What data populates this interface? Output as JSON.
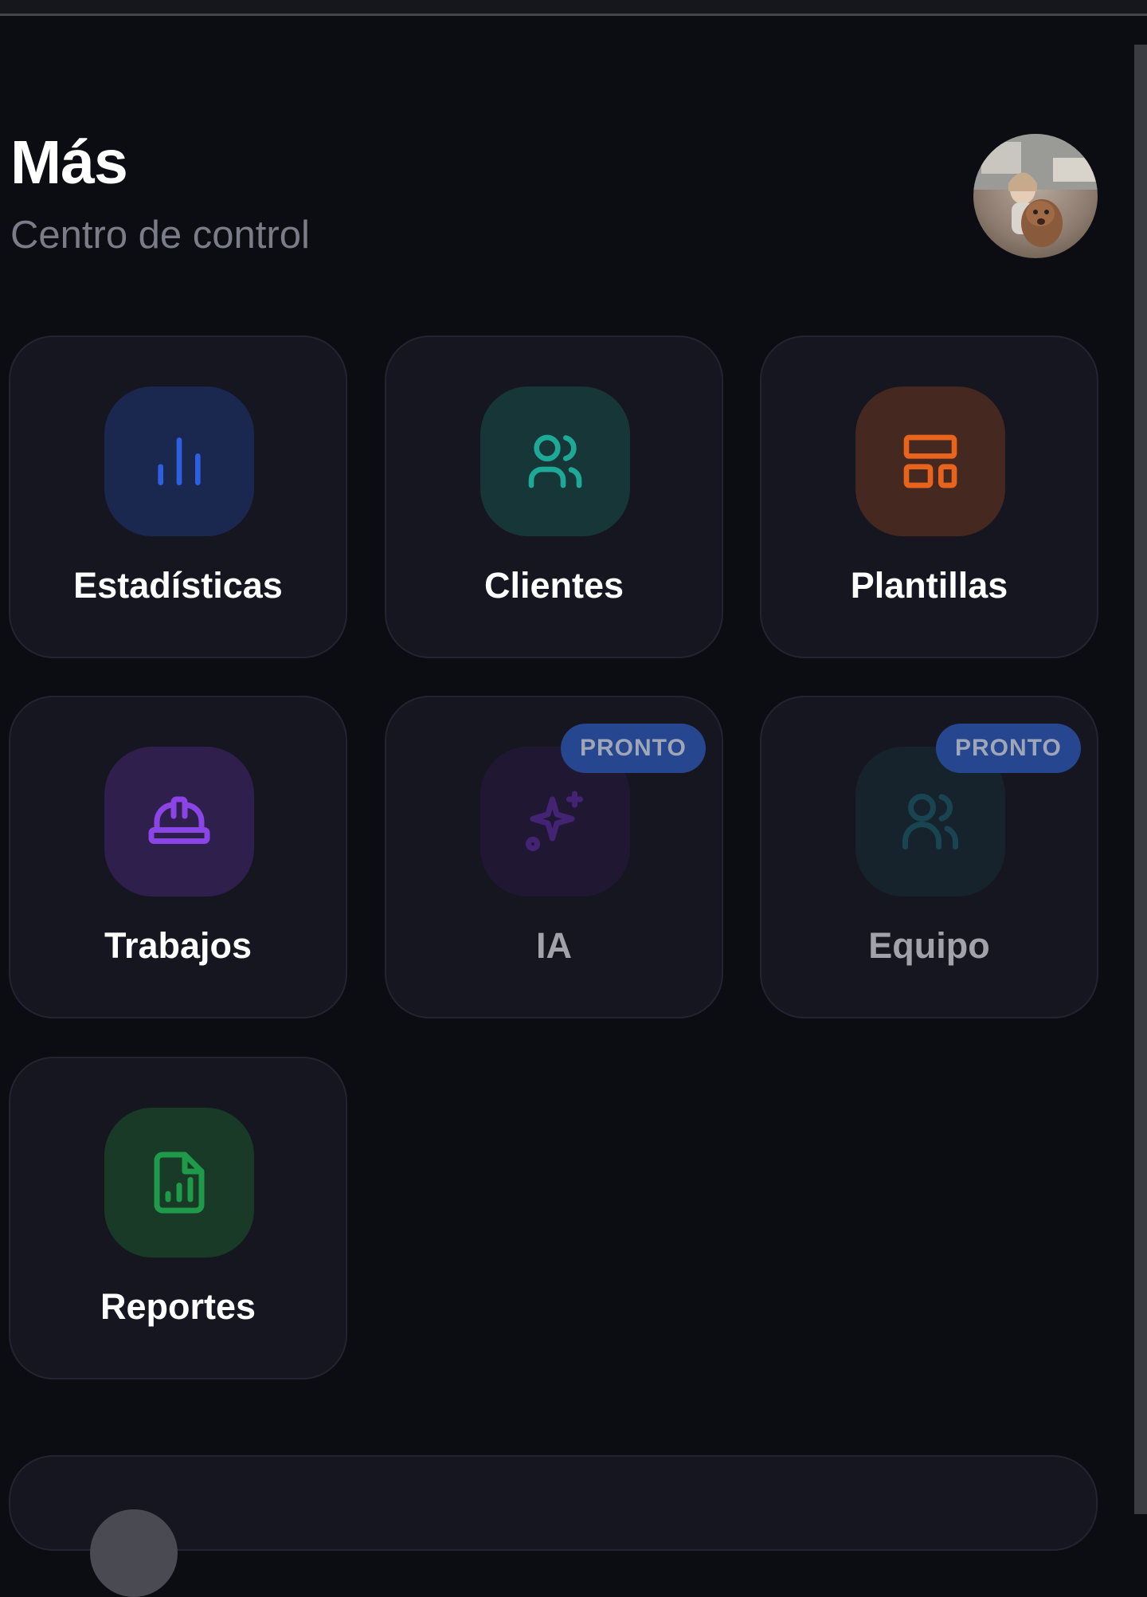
{
  "header": {
    "title": "Más",
    "subtitle": "Centro de control"
  },
  "tiles": [
    {
      "label": "Estadísticas",
      "icon": "bar-chart-icon",
      "accent": "#2d5fe0",
      "icon_bg": "#1a2850",
      "enabled": true
    },
    {
      "label": "Clientes",
      "icon": "users-icon",
      "accent": "#1ea896",
      "icon_bg": "#173637",
      "enabled": true
    },
    {
      "label": "Plantillas",
      "icon": "layout-template-icon",
      "accent": "#e8641c",
      "icon_bg": "#452920",
      "enabled": true
    },
    {
      "label": "Trabajos",
      "icon": "hard-hat-icon",
      "accent": "#8b44e6",
      "icon_bg": "#2e1f4d",
      "enabled": true
    },
    {
      "label": "IA",
      "icon": "sparkles-icon",
      "accent": "#6a2fb8",
      "icon_bg": "#2a1a44",
      "enabled": false,
      "badge": "PRONTO"
    },
    {
      "label": "Equipo",
      "icon": "users-icon",
      "accent": "#1e6a7a",
      "icon_bg": "#1a2f38",
      "enabled": false,
      "badge": "PRONTO"
    },
    {
      "label": "Reportes",
      "icon": "file-chart-icon",
      "accent": "#1f9a4a",
      "icon_bg": "#183a27",
      "enabled": true
    }
  ]
}
